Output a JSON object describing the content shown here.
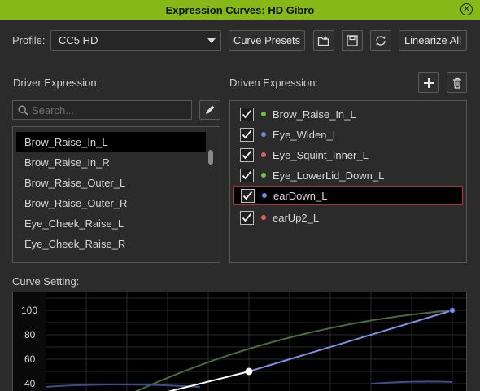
{
  "window": {
    "title": "Expression Curves: HD Gibro"
  },
  "toolbar": {
    "profile_label": "Profile:",
    "profile_value": "CC5 HD",
    "curve_presets_label": "Curve Presets",
    "linearize_all_label": "Linearize All"
  },
  "driver": {
    "label": "Driver Expression:",
    "search_placeholder": "Search...",
    "items": [
      "Brow_Raise_In_L",
      "Brow_Raise_In_R",
      "Brow_Raise_Outer_L",
      "Brow_Raise_Outer_R",
      "Eye_Cheek_Raise_L",
      "Eye_Cheek_Raise_R"
    ],
    "selected_index": 0
  },
  "driven": {
    "label": "Driven Expression:",
    "items": [
      {
        "label": "Brow_Raise_In_L",
        "checked": true,
        "dot_color": "#6fbf4a"
      },
      {
        "label": "Eye_Widen_L",
        "checked": true,
        "dot_color": "#6f86e8"
      },
      {
        "label": "Eye_Squint_Inner_L",
        "checked": true,
        "dot_color": "#e06060"
      },
      {
        "label": "Eye_LowerLid_Down_L",
        "checked": true,
        "dot_color": "#6fbf4a"
      },
      {
        "label": "earDown_L",
        "checked": true,
        "dot_color": "#6f86e8"
      },
      {
        "label": "earUp2_L",
        "checked": true,
        "dot_color": "#e06060"
      }
    ],
    "selected_index": 4
  },
  "curve": {
    "label": "Curve Setting:",
    "y_ticks": [
      "100",
      "80",
      "60",
      "40"
    ],
    "colors": {
      "linear": "#7f8fe6",
      "upper": "#4a6a3e",
      "lower": "#3a4e8a",
      "selected": "#ffffff"
    }
  }
}
